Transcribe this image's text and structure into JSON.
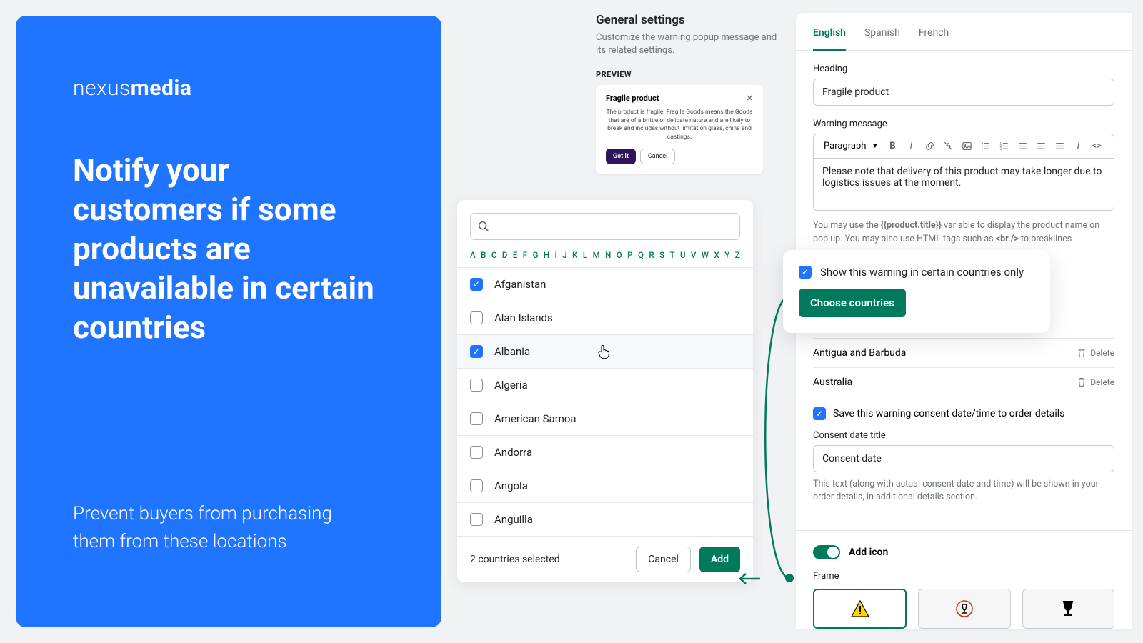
{
  "hero": {
    "brand_light": "nexus",
    "brand_bold": "media",
    "headline": "Notify your customers if some products are unavailable in certain countries",
    "subhead": "Prevent buyers from purchasing them from these locations"
  },
  "picker": {
    "search_placeholder": "",
    "alphabet": [
      "A",
      "B",
      "C",
      "D",
      "E",
      "F",
      "G",
      "H",
      "I",
      "J",
      "K",
      "L",
      "M",
      "N",
      "O",
      "P",
      "Q",
      "R",
      "S",
      "T",
      "U",
      "V",
      "W",
      "X",
      "Y",
      "Z"
    ],
    "rows": [
      {
        "label": "Afganistan",
        "checked": true
      },
      {
        "label": "Alan Islands",
        "checked": false
      },
      {
        "label": "Albania",
        "checked": true,
        "hover": true
      },
      {
        "label": "Algeria",
        "checked": false
      },
      {
        "label": "American Samoa",
        "checked": false
      },
      {
        "label": "Andorra",
        "checked": false
      },
      {
        "label": "Angola",
        "checked": false
      },
      {
        "label": "Anguilla",
        "checked": false
      }
    ],
    "count_label": "2 countries selected",
    "cancel": "Cancel",
    "add": "Add"
  },
  "general": {
    "title": "General settings",
    "desc": "Customize the warning popup message and its related settings.",
    "preview_label": "PREVIEW",
    "preview": {
      "title": "Fragile product",
      "body": "The product is fragile. Fragile Goods means the Goods that are of a brittle or delicate nature and are likely to break and includes without limitation glass, china and castings.",
      "gotit": "Got it",
      "cancel": "Cancel"
    }
  },
  "editor": {
    "tabs": [
      "English",
      "Spanish",
      "French"
    ],
    "active_tab": 0,
    "heading_label": "Heading",
    "heading_value": "Fragile product",
    "msg_label": "Warning message",
    "paragraph": "Paragraph",
    "msg_value": "Please note that delivery of this product may take longer due to logistics issues at the moment.",
    "hint_1": "You may use the ",
    "hint_var": "{{product.title}}",
    "hint_2": " variable to display the product name on pop up. You may also use HTML tags such as ",
    "hint_br": "<br />",
    "hint_3": " to breaklines"
  },
  "float": {
    "checkbox_label": "Show this warning in certain countries only",
    "button": "Choose countries"
  },
  "selected_countries": [
    {
      "name": "Antigua and Barbuda",
      "del": "Delete"
    },
    {
      "name": "Australia",
      "del": "Delete"
    }
  ],
  "consent": {
    "checkbox_label": "Save this warning consent date/time to order details",
    "title_label": "Consent date title",
    "title_value": "Consent date",
    "hint": "This text (along with actual consent date and time) will be shown in your order details, in additional details section."
  },
  "iconsec": {
    "toggle_label": "Add icon",
    "frame_label": "Frame",
    "frames": [
      "warning-triangle",
      "fragile-circle",
      "fragile-glass"
    ],
    "selected": 0
  }
}
